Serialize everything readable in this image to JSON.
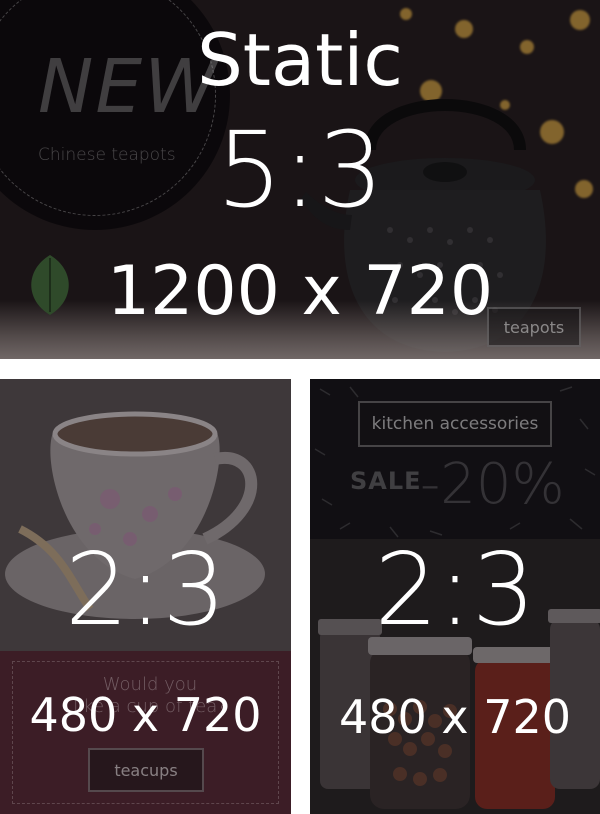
{
  "top_banner": {
    "heading": "Static",
    "ratio": "5:3",
    "size": "1200 x 720",
    "promo_title": "NEW",
    "promo_subtitle": "Chinese teapots",
    "button_label": "teapots"
  },
  "left_banner": {
    "ratio": "2:3",
    "size": "480 x 720",
    "promo_text_line1": "Would you",
    "promo_text_line2": "like a cup of tea?",
    "button_label": "teacups"
  },
  "right_banner": {
    "ratio": "2:3",
    "size": "480 x 720",
    "button_label": "kitchen accessories",
    "sale_label": "SALE",
    "sale_value": "-20%"
  },
  "colors": {
    "page_background": "#ffffff",
    "overlay_text": "#ffffff",
    "teacups_panel": "#3c1d26",
    "bokeh_accent": "#d8a640"
  }
}
